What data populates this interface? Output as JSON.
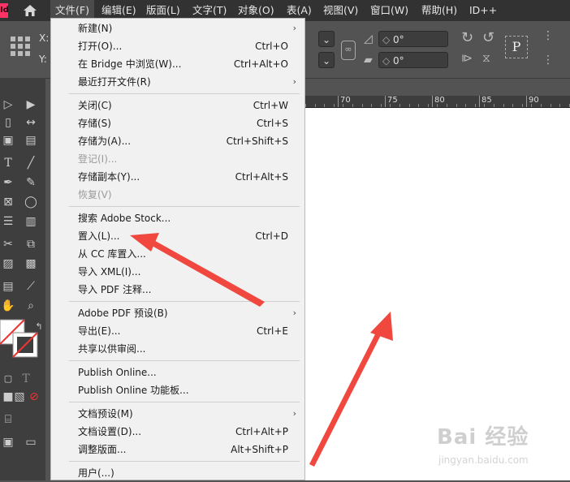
{
  "app": {
    "icon_text": "Id"
  },
  "menubar": {
    "items": [
      {
        "label": "文件(F)",
        "active": true
      },
      {
        "label": "编辑(E)"
      },
      {
        "label": "版面(L)"
      },
      {
        "label": "文字(T)"
      },
      {
        "label": "对象(O)"
      },
      {
        "label": "表(A)"
      },
      {
        "label": "视图(V)"
      },
      {
        "label": "窗口(W)"
      },
      {
        "label": "帮助(H)"
      },
      {
        "label": "ID++"
      }
    ]
  },
  "control": {
    "x_label": "X:",
    "y_label": "Y:",
    "angle1": "0°",
    "angle2": "0°",
    "p_glyph": "P"
  },
  "ruler": {
    "ticks": [
      "70",
      "75",
      "80",
      "85",
      "90"
    ]
  },
  "file_menu": {
    "groups": [
      [
        {
          "label": "新建(N)",
          "submenu": true
        },
        {
          "label": "打开(O)...",
          "shortcut": "Ctrl+O"
        },
        {
          "label": "在 Bridge 中浏览(W)...",
          "shortcut": "Ctrl+Alt+O"
        },
        {
          "label": "最近打开文件(R)",
          "submenu": true
        }
      ],
      [
        {
          "label": "关闭(C)",
          "shortcut": "Ctrl+W"
        },
        {
          "label": "存储(S)",
          "shortcut": "Ctrl+S"
        },
        {
          "label": "存储为(A)...",
          "shortcut": "Ctrl+Shift+S"
        },
        {
          "label": "登记(I)...",
          "disabled": true
        },
        {
          "label": "存储副本(Y)...",
          "shortcut": "Ctrl+Alt+S"
        },
        {
          "label": "恢复(V)",
          "disabled": true
        }
      ],
      [
        {
          "label": "搜索 Adobe Stock..."
        },
        {
          "label": "置入(L)...",
          "shortcut": "Ctrl+D"
        },
        {
          "label": "从 CC 库置入..."
        },
        {
          "label": "导入 XML(I)..."
        },
        {
          "label": "导入 PDF 注释..."
        }
      ],
      [
        {
          "label": "Adobe PDF 预设(B)",
          "submenu": true
        },
        {
          "label": "导出(E)...",
          "shortcut": "Ctrl+E"
        },
        {
          "label": "共享以供审阅..."
        }
      ],
      [
        {
          "label": "Publish Online..."
        },
        {
          "label": "Publish Online 功能板..."
        }
      ],
      [
        {
          "label": "文档预设(M)",
          "submenu": true
        },
        {
          "label": "文档设置(D)...",
          "shortcut": "Ctrl+Alt+P"
        },
        {
          "label": "调整版面...",
          "shortcut": "Alt+Shift+P"
        }
      ],
      [
        {
          "label": "用户(...)"
        }
      ]
    ],
    "submenu_glyph": "›"
  },
  "watermark": {
    "brand": "Bai 经验",
    "url": "jingyan.baidu.com"
  },
  "colors": {
    "arrow": "#f0473e",
    "menu_bg": "#f1f1f1",
    "menubar_bg": "#323232"
  }
}
